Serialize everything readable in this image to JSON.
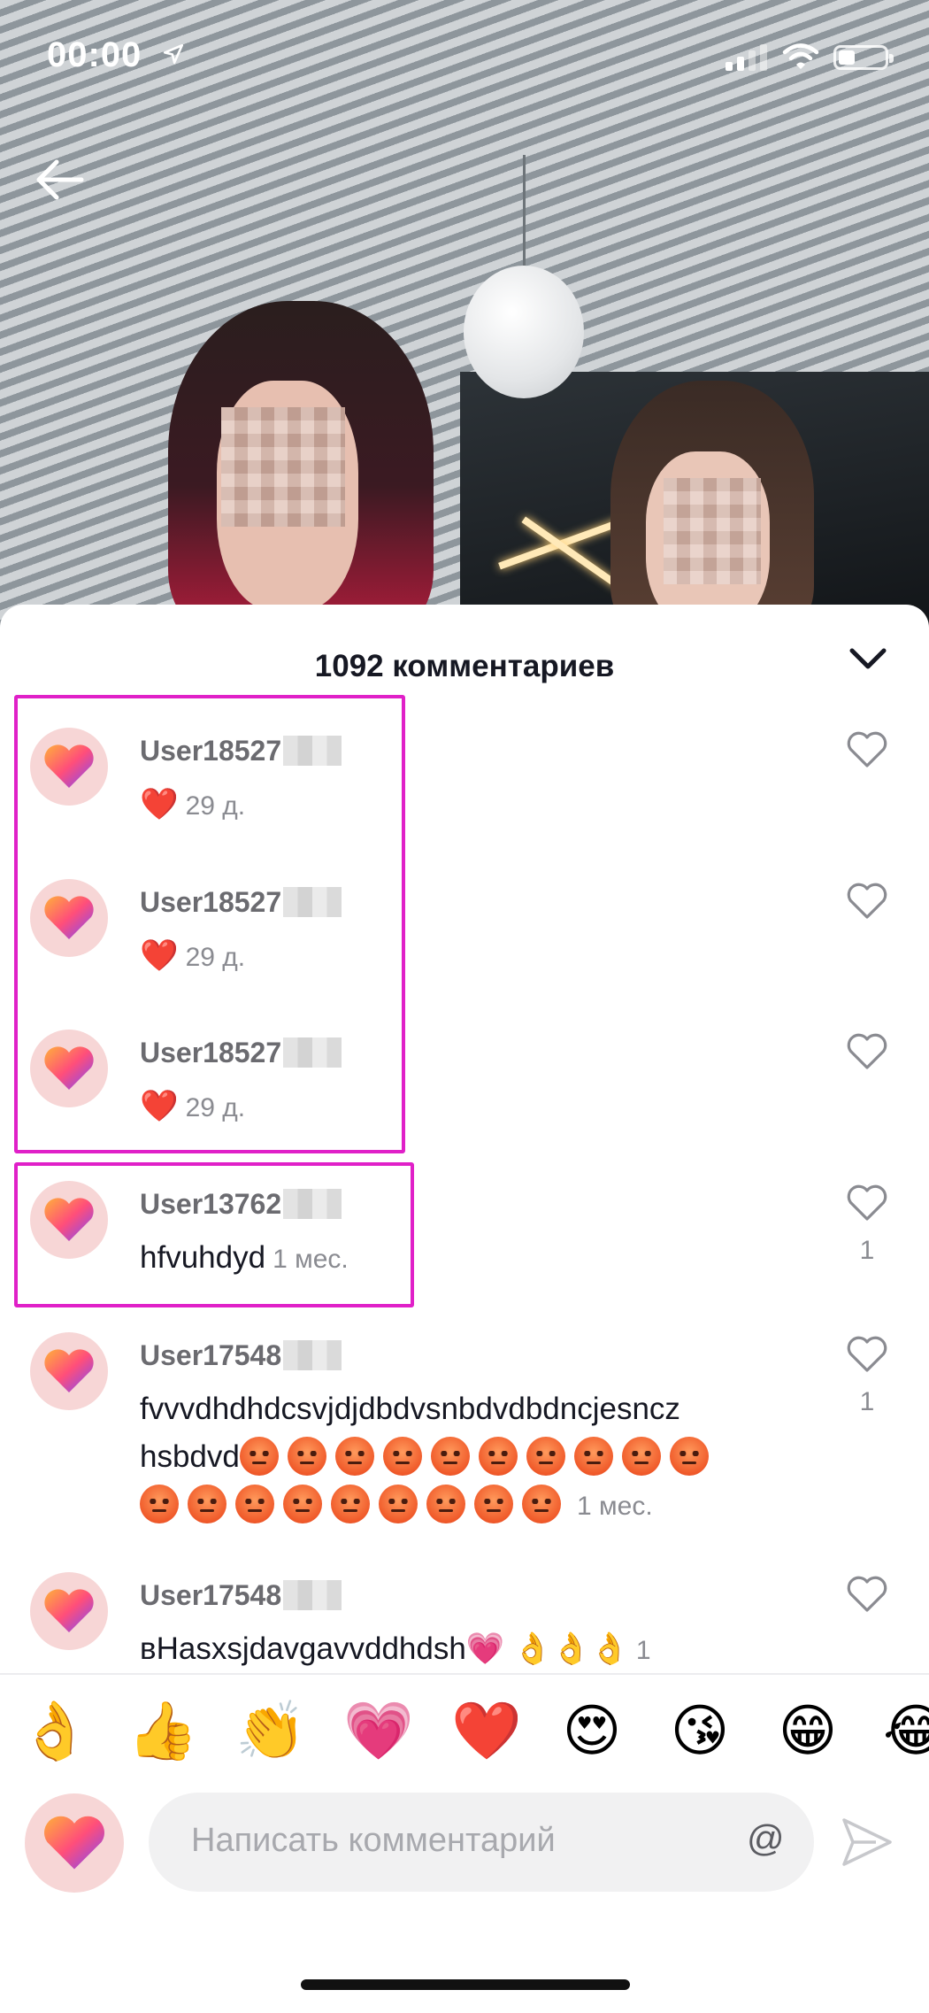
{
  "status_bar": {
    "time": "00:00",
    "icons": [
      "location-arrow-icon",
      "signal-icon",
      "wifi-icon",
      "battery-icon"
    ]
  },
  "header": {
    "back_icon": "arrow-left-icon"
  },
  "comments_sheet": {
    "title": "1092 комментариев",
    "collapse_icon": "chevron-down-icon",
    "comments": [
      {
        "username": "User18527",
        "text": "",
        "emoji": "❤️",
        "time": "29 д.",
        "likes": ""
      },
      {
        "username": "User18527",
        "text": "",
        "emoji": "❤️",
        "time": "29 д.",
        "likes": ""
      },
      {
        "username": "User18527",
        "text": "",
        "emoji": "❤️",
        "time": "29 д.",
        "likes": ""
      },
      {
        "username": "User13762",
        "text": "hfvuhdyd",
        "time": "1 мес.",
        "likes": "1"
      },
      {
        "username": "User17548",
        "text_line1": "fvvvdhdhdcsvjdjdbdvsnbdvdbdncjesncz",
        "text_line2": "hsbdvd",
        "angry_emoji_count_line2": 10,
        "angry_emoji_count_line3": 9,
        "time": "1 мес.",
        "likes": "1"
      },
      {
        "username": "User17548",
        "text": "вHasxsjdavgavvddhdsh💗 👌👌👌",
        "time": "1",
        "likes": ""
      }
    ]
  },
  "emoji_bar": [
    "👌",
    "👍",
    "👏",
    "💗",
    "❤️",
    "😍",
    "😘",
    "😁",
    "😂"
  ],
  "composer": {
    "placeholder": "Написать комментарий",
    "mention_symbol": "@",
    "send_icon": "send-icon"
  },
  "colors": {
    "highlight_box": "#e020c8",
    "username": "#6b6b70",
    "meta": "#8a8b91",
    "heart_red": "#e0202c"
  }
}
